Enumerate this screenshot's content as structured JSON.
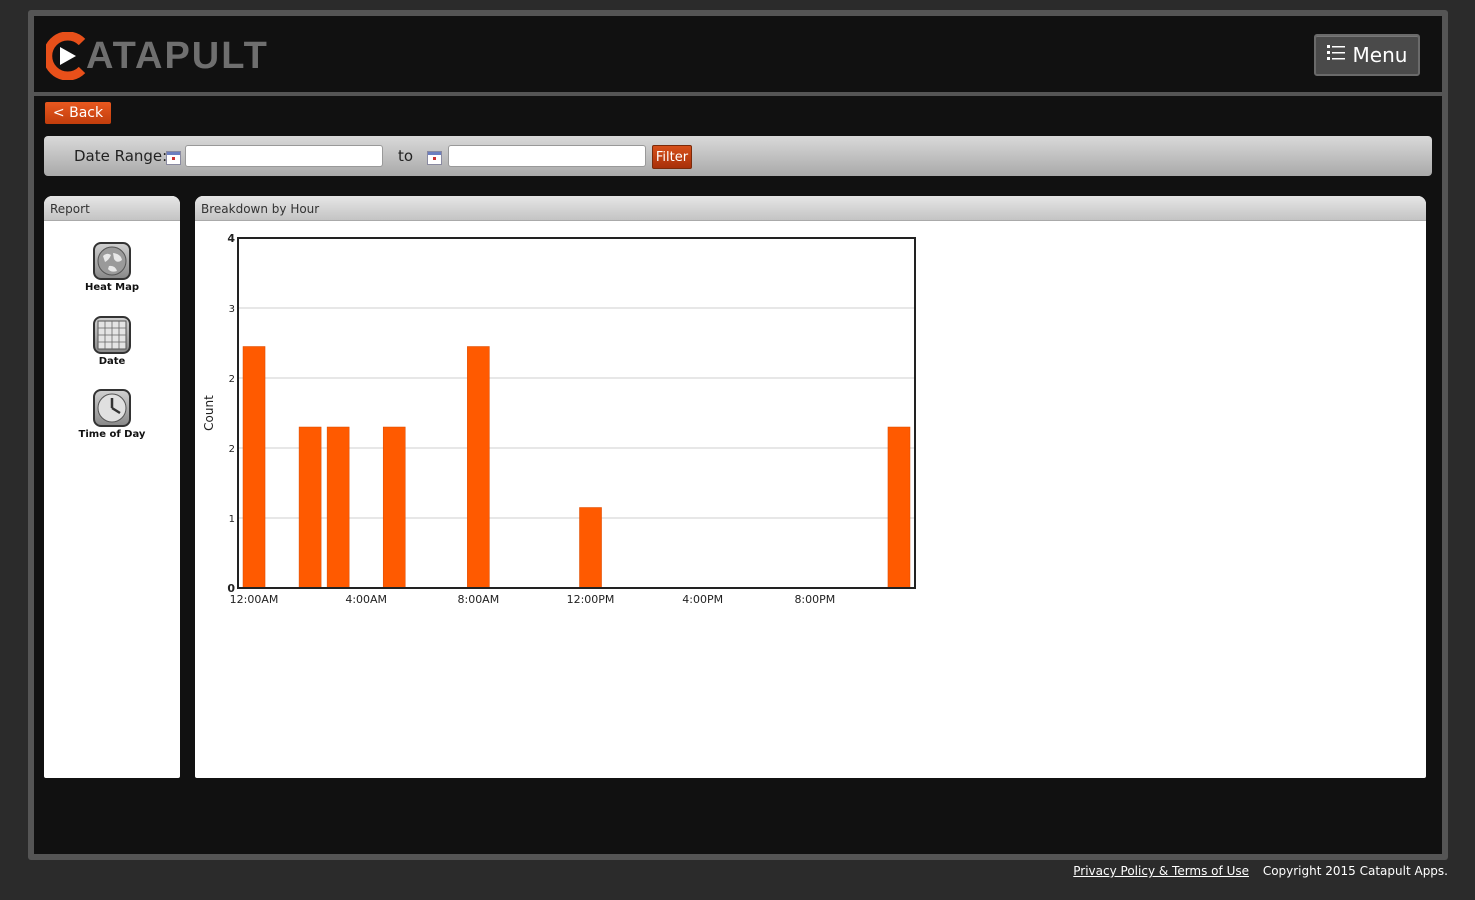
{
  "header": {
    "logo_text": "ATAPULT",
    "menu_label": "Menu"
  },
  "toolbar": {
    "back_label": "< Back",
    "date_range_label": "Date Range:",
    "to_label": "to",
    "start_value": "",
    "end_value": "",
    "filter_label": "Filter"
  },
  "report_panel": {
    "title": "Report",
    "items": [
      {
        "label": "Heat Map",
        "icon": "globe-icon"
      },
      {
        "label": "Date",
        "icon": "calendar-icon"
      },
      {
        "label": "Time of Day",
        "icon": "clock-icon"
      }
    ]
  },
  "chart_panel": {
    "title": "Breakdown by Hour"
  },
  "footer": {
    "privacy_link": "Privacy Policy & Terms of Use",
    "copyright": "Copyright 2015 Catapult Apps."
  },
  "colors": {
    "accent": "#ff5a00",
    "button": "#d6501a"
  },
  "chart_data": {
    "type": "bar",
    "title": "",
    "xlabel": "",
    "ylabel": "Count",
    "ylim": [
      0,
      4
    ],
    "yticks": [
      0,
      1,
      2,
      2,
      3,
      4
    ],
    "ytick_values": [
      0,
      0.8,
      1.6,
      2.4,
      3.2,
      4
    ],
    "xtick_labels": [
      "12:00AM",
      "4:00AM",
      "8:00AM",
      "12:00PM",
      "4:00PM",
      "8:00PM"
    ],
    "xtick_hours": [
      0,
      4,
      8,
      12,
      16,
      20
    ],
    "grid": true,
    "hours": [
      0,
      2,
      3,
      5,
      8,
      12,
      23
    ],
    "values": [
      3,
      2,
      2,
      2,
      3,
      1,
      2
    ]
  }
}
